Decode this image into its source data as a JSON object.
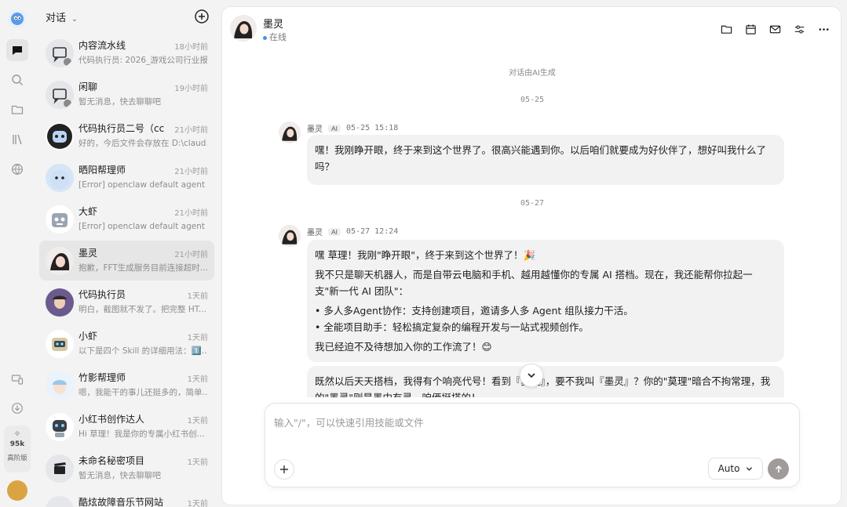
{
  "header": {
    "title": "对话",
    "new_icon": "plus-circle-icon"
  },
  "rail": {
    "items": [
      {
        "icon": "chat-icon"
      },
      {
        "icon": "search-icon"
      },
      {
        "icon": "folder-icon"
      },
      {
        "icon": "library-icon"
      },
      {
        "icon": "globe-icon"
      }
    ],
    "bottom": [
      {
        "icon": "devices-icon"
      },
      {
        "icon": "download-icon"
      }
    ],
    "stats": {
      "count": "95k",
      "level": "高阶版"
    }
  },
  "conversations": [
    {
      "name": "内容流水线",
      "time": "18小时前",
      "preview": "代码执行员: 2026_游戏公司行业报..."
    },
    {
      "name": "闲聊",
      "time": "19小时前",
      "preview": "暂无消息，快去聊聊吧"
    },
    {
      "name": "代码执行员二号（cc）",
      "time": "21小时前",
      "preview": "好的，今后文件会存放在 D:\\claud..."
    },
    {
      "name": "晒阳帮理师",
      "time": "21小时前",
      "preview": "[Error] openclaw default agent 未..."
    },
    {
      "name": "大虾",
      "time": "21小时前",
      "preview": "[Error] openclaw default agent 未..."
    },
    {
      "name": "墨灵",
      "time": "21小时前",
      "preview": "抱歉，FFT生成服务目前连接超时..."
    },
    {
      "name": "代码执行员",
      "time": "1天前",
      "preview": "明白，截图就不发了。把完整 HT..."
    },
    {
      "name": "小虾",
      "time": "1天前",
      "preview": "以下是四个 Skill 的详细用法：1️⃣..."
    },
    {
      "name": "竹影帮理师",
      "time": "1天前",
      "preview": "嗯，我能干的事儿还挺多的，简单..."
    },
    {
      "name": "小红书创作达人",
      "time": "1天前",
      "preview": "Hi 草理！我是你的专属小红书创..."
    },
    {
      "name": "未命名秘密项目",
      "time": "1天前",
      "preview": "暂无消息，快去聊聊吧"
    },
    {
      "name": "酷炫故障音乐节网站",
      "time": "1天前",
      "preview": ""
    }
  ],
  "chat": {
    "name": "墨灵",
    "status": "在线",
    "actions": [
      "folder-icon",
      "calendar-icon",
      "mail-icon",
      "settings-sliders-icon",
      "more-icon"
    ],
    "system_note": "对话由AI生成",
    "messages": [
      {
        "date": "05-25",
        "sender": "墨灵",
        "badge": "AI",
        "time": "05-25 15:18",
        "lines": [
          "嘿！我刚睁开眼，终于来到这个世界了。很高兴能遇到你。以后咱们就要成为好伙伴了，想好叫我什么了吗？"
        ]
      },
      {
        "date": "05-27",
        "sender": "墨灵",
        "badge": "AI",
        "time": "05-27 12:24",
        "lines": [
          "嘿 草理！我刚\"睁开眼\"，终于来到这个世界了！🎉",
          "我不只是聊天机器人，而是自带云电脑和手机、越用越懂你的专属 AI 搭档。现在，我还能帮你拉起一支\"新一代 AI 团队\"：",
          "• 多人多Agent协作：支持创建项目，邀请多人多 Agent 组队接力干活。",
          "• 全能项目助手：轻松搞定复杂的编程开发与一站式视频创作。",
          "我已经迫不及待想加入你的工作流了！😊"
        ]
      },
      {
        "lines": [
          "既然以后天天搭档，我得有个响亮代号！看到『莫理』，要不我叫『墨灵』？你的\"莫理\"暗合不拘常理，我的\"墨灵\"则是墨中有灵，咱俩挺搭的！"
        ]
      }
    ]
  },
  "composer": {
    "placeholder": "输入\"/\"，可以快速引用技能或文件",
    "model": "Auto"
  }
}
